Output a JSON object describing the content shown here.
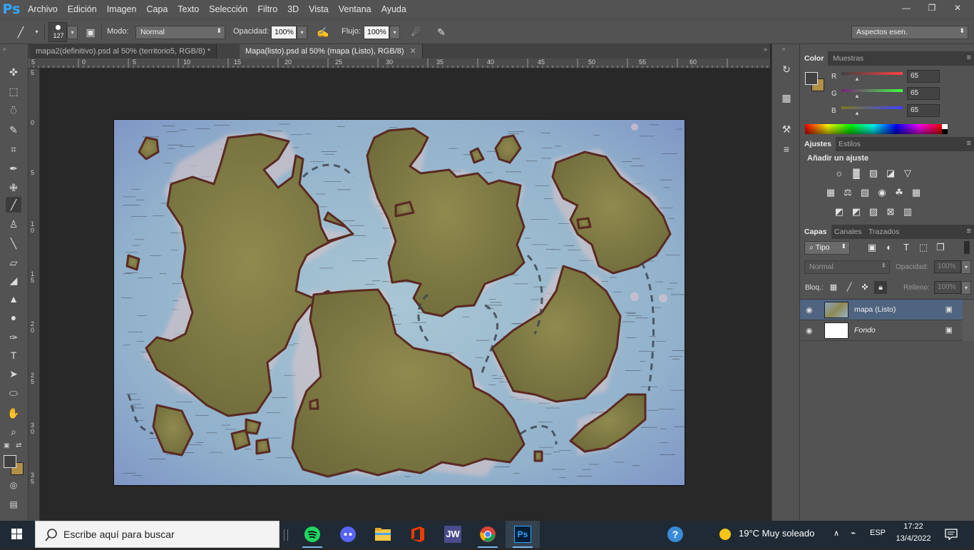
{
  "app": {
    "logo": "Ps",
    "menu": [
      "Archivo",
      "Edición",
      "Imagen",
      "Capa",
      "Texto",
      "Selección",
      "Filtro",
      "3D",
      "Vista",
      "Ventana",
      "Ayuda"
    ],
    "window_controls": [
      "minimize-icon",
      "restore-icon",
      "close-icon"
    ]
  },
  "options": {
    "brush_size": "127",
    "mode_label": "Modo:",
    "mode_value": "Normal",
    "opacity_label": "Opacidad:",
    "opacity_value": "100%",
    "flow_label": "Flujo:",
    "flow_value": "100%",
    "workspace": "Aspectos esen."
  },
  "tabs": [
    {
      "label": "mapa2(definitivo).psd al 50% (territorio5, RGB/8) *",
      "active": false
    },
    {
      "label": "Mapa(listo).psd al 50% (mapa (Listo), RGB/8)",
      "active": true
    }
  ],
  "ruler": {
    "top": [
      "5",
      "0",
      "5",
      "10",
      "15",
      "20",
      "25",
      "30",
      "35",
      "40",
      "45",
      "50",
      "55",
      "60"
    ],
    "left": [
      "5",
      "0",
      "5",
      "1 0",
      "1 5",
      "2 0",
      "2 5",
      "3 0",
      "3 5"
    ]
  },
  "color_panel": {
    "tabs": [
      "Color",
      "Muestras"
    ],
    "channels": [
      {
        "name": "R",
        "value": "65"
      },
      {
        "name": "G",
        "value": "65"
      },
      {
        "name": "B",
        "value": "65"
      }
    ],
    "foreground": "#414141",
    "background": "#b08f48"
  },
  "adjust_panel": {
    "tabs": [
      "Ajustes",
      "Estilos"
    ],
    "heading": "Añadir un ajuste"
  },
  "layers_panel": {
    "tabs": [
      "Capas",
      "Canales",
      "Trazados"
    ],
    "filter_kind": "Tipo",
    "blend_mode": "Normal",
    "opacity_label": "Opacidad:",
    "opacity_value": "100%",
    "lock_label": "Bloq.:",
    "fill_label": "Relleno:",
    "fill_value": "100%",
    "layers": [
      {
        "name": "mapa (Listo)",
        "selected": true
      },
      {
        "name": "Fondo",
        "selected": false
      }
    ]
  },
  "taskbar": {
    "search_placeholder": "Escribe aquí para buscar",
    "apps": [
      "spotify-icon",
      "discord-icon",
      "file-explorer-icon",
      "office-icon",
      "jw-icon",
      "chrome-icon",
      "photoshop-icon"
    ],
    "jw_label": "JW",
    "ps_label": "Ps",
    "weather": "19°C  Muy soleado",
    "language": "ESP",
    "time": "17:22",
    "date": "13/4/2022"
  }
}
